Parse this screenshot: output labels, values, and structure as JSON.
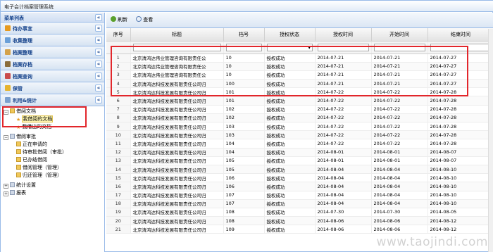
{
  "app_title": "电子会计档案管理系统",
  "left": {
    "header": "菜单列表",
    "sections": [
      {
        "label": "待办事宜",
        "icon": "todo-icon",
        "color": "#e69a1f"
      },
      {
        "label": "收集整理",
        "icon": "collect-icon",
        "color": "#6a9fd8"
      },
      {
        "label": "档案整理",
        "icon": "archive-icon",
        "color": "#d4a24a"
      },
      {
        "label": "档案存档",
        "icon": "store-icon",
        "color": "#8a6d3b"
      },
      {
        "label": "档案查询",
        "icon": "query-icon",
        "color": "#c94b4b"
      },
      {
        "label": "保管",
        "icon": "keep-icon",
        "color": "#e6b32e"
      },
      {
        "label": "利用&统计",
        "icon": "stats-icon",
        "color": "#7aa0cf"
      }
    ],
    "tree": {
      "borrow_docs": "借阅文档",
      "my_borrowed": "我借阅的文档",
      "my_lent": "我借出的文档",
      "borrow_approval": "借阅审批",
      "applying": "正在申请的",
      "pending": "待审批借阅（审批）",
      "finished": "已办结借阅",
      "borrow_manage": "借阅管理（管理）",
      "return_manage": "归还管理（管理）",
      "stats_settings": "统计设置",
      "reports": "报表"
    }
  },
  "toolbar": {
    "refresh": "刷新",
    "view": "查看"
  },
  "grid": {
    "columns": [
      "序号",
      "标题",
      "档号",
      "授权状态",
      "授权时间",
      "开始时间",
      "结束时间"
    ],
    "rows": [
      [
        "1",
        "北京清鸿达伟业管理咨询有限责任公",
        "10",
        "授权成功",
        "2014-07-21",
        "2014-07-21",
        "2014-07-27"
      ],
      [
        "2",
        "北京清鸿达伟业管理咨询有限责任公",
        "10",
        "授权成功",
        "2014-07-21",
        "2014-07-21",
        "2014-07-27"
      ],
      [
        "3",
        "北京清鸿达伟业管理咨询有限责任公",
        "10",
        "授权成功",
        "2014-07-21",
        "2014-07-21",
        "2014-07-27"
      ],
      [
        "4",
        "北京清鸿达科技发展有限责任公司归",
        "100",
        "授权成功",
        "2014-07-21",
        "2014-07-21",
        "2014-07-27"
      ],
      [
        "5",
        "北京清鸿达科技发展有限责任公司归",
        "101",
        "授权成功",
        "2014-07-22",
        "2014-07-22",
        "2014-07-28"
      ],
      [
        "6",
        "北京清鸿达科技发展有限责任公司归",
        "101",
        "授权成功",
        "2014-07-22",
        "2014-07-22",
        "2014-07-28"
      ],
      [
        "7",
        "北京清鸿达科技发展有限责任公司归",
        "102",
        "授权成功",
        "2014-07-22",
        "2014-07-22",
        "2014-07-28"
      ],
      [
        "8",
        "北京清鸿达科技发展有限责任公司归",
        "102",
        "授权成功",
        "2014-07-22",
        "2014-07-22",
        "2014-07-28"
      ],
      [
        "9",
        "北京清鸿达科技发展有限责任公司归",
        "103",
        "授权成功",
        "2014-07-22",
        "2014-07-22",
        "2014-07-28"
      ],
      [
        "10",
        "北京清鸿达科技发展有限责任公司归",
        "103",
        "授权成功",
        "2014-07-22",
        "2014-07-22",
        "2014-07-28"
      ],
      [
        "11",
        "北京清鸿达科技发展有限责任公司归",
        "104",
        "授权成功",
        "2014-07-22",
        "2014-07-22",
        "2014-07-28"
      ],
      [
        "12",
        "北京清鸿达科技发展有限责任公司归",
        "104",
        "授权成功",
        "2014-08-01",
        "2014-08-01",
        "2014-08-07"
      ],
      [
        "13",
        "北京清鸿达科技发展有限责任公司归",
        "105",
        "授权成功",
        "2014-08-01",
        "2014-08-01",
        "2014-08-07"
      ],
      [
        "14",
        "北京清鸿达科技发展有限责任公司归",
        "105",
        "授权成功",
        "2014-08-04",
        "2014-08-04",
        "2014-08-10"
      ],
      [
        "15",
        "北京清鸿达科技发展有限责任公司归",
        "106",
        "授权成功",
        "2014-08-04",
        "2014-08-04",
        "2014-08-10"
      ],
      [
        "16",
        "北京清鸿达科技发展有限责任公司归",
        "106",
        "授权成功",
        "2014-08-04",
        "2014-08-04",
        "2014-08-10"
      ],
      [
        "17",
        "北京清鸿达科技发展有限责任公司归",
        "107",
        "授权成功",
        "2014-08-04",
        "2014-08-04",
        "2014-08-10"
      ],
      [
        "18",
        "北京清鸿达科技发展有限责任公司归",
        "107",
        "授权成功",
        "2014-08-04",
        "2014-08-04",
        "2014-08-10"
      ],
      [
        "19",
        "北京清鸿达科技发展有限责任公司归",
        "108",
        "授权成功",
        "2014-07-30",
        "2014-07-30",
        "2014-08-05"
      ],
      [
        "20",
        "北京清鸿达科技发展有限责任公司归",
        "108",
        "授权成功",
        "2014-08-06",
        "2014-08-06",
        "2014-08-12"
      ],
      [
        "21",
        "北京清鸿达科技发展有限责任公司归",
        "109",
        "授权成功",
        "2014-08-06",
        "2014-08-06",
        "2014-08-12"
      ]
    ]
  },
  "watermark": "www.taojindi.com",
  "colors": {
    "highlight_box": "#e2262b",
    "header_blue": "#15428b"
  }
}
